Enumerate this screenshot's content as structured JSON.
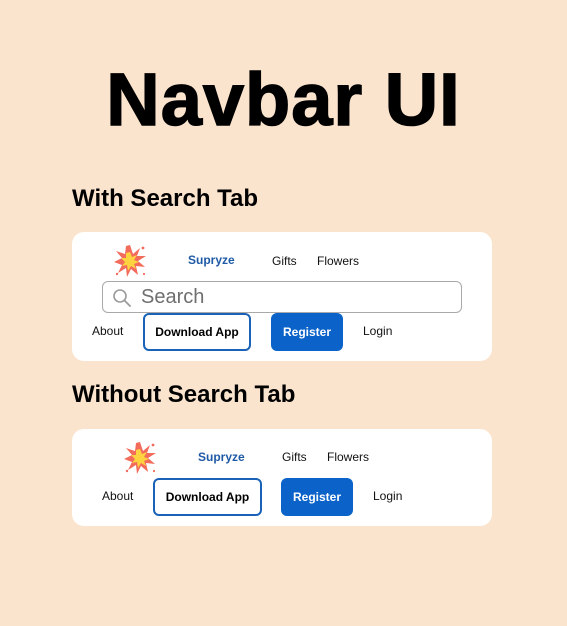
{
  "page": {
    "title": "Navbar UI"
  },
  "sections": {
    "with_search": {
      "heading": "With Search Tab",
      "brand": "Supryze",
      "links": [
        "Gifts",
        "Flowers"
      ],
      "search_placeholder": "Search",
      "about": "About",
      "download_label": "Download App",
      "register_label": "Register",
      "login_label": "Login"
    },
    "without_search": {
      "heading": "Without Search Tab",
      "brand": "Supryze",
      "links": [
        "Gifts",
        "Flowers"
      ],
      "about": "About",
      "download_label": "Download App",
      "register_label": "Register",
      "login_label": "Login"
    }
  },
  "icons": {
    "logo": "collision-burst-icon",
    "search": "magnifier-icon"
  },
  "colors": {
    "background": "#fbe4cd",
    "brand_text": "#1f5aa6",
    "primary_button": "#0b63c9",
    "outline_border": "#1a62b8"
  }
}
